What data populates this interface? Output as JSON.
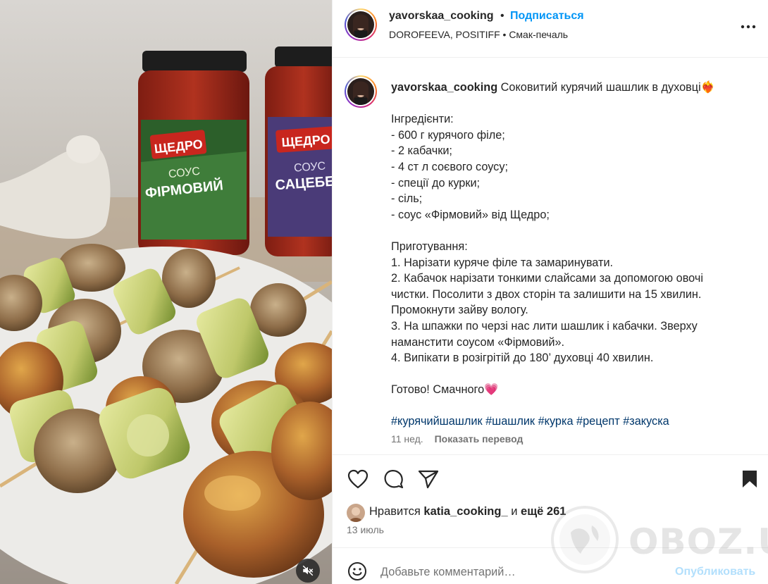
{
  "header": {
    "username": "yavorskaa_cooking",
    "separator": "•",
    "follow_label": "Подписаться",
    "audio": "DOROFEEVA, POSITIFF • Смак-печаль",
    "more_icon": "more-horizontal-icon"
  },
  "media": {
    "jars": [
      {
        "brand": "ЩЕДРО",
        "type": "СОУС",
        "name": "ФІРМОВИЙ",
        "label_color": "#3f7d3a"
      },
      {
        "brand": "ЩЕДРО",
        "type": "СОУС",
        "name": "САЦЕБЕЛ",
        "label_color": "#4a3b78"
      }
    ],
    "mute_icon": "speaker-muted-icon"
  },
  "caption": {
    "username": "yavorskaa_cooking",
    "title": "Соковитий курячий шашлик в духовці",
    "title_emoji": "❤️‍🔥",
    "ingredients_header": "Інгредієнти:",
    "ingredients": [
      "- 600 г курячого філе;",
      "- 2 кабачки;",
      "- 4 ст л соєвого соусу;",
      "- спеції до курки;",
      "- сіль;",
      "- соус «Фірмовий» від Щедро;"
    ],
    "steps_header": "Приготування:",
    "steps_lines": [
      "1. Нарізати куряче філе та замаринувати.",
      "2. Кабачок нарізати тонкими слайсами за допомогою овочі",
      "чистки. Посолити з двох сторін та залишити на 15 хвилин.",
      "Промокнути зайву вологу.",
      "3. На шпажки по черзі нас лити шашлик і кабачки. Зверху",
      "наманстити соусом «Фірмовий».",
      "4. Випікати в розігрітій до 180’ духовці 40 хвилин."
    ],
    "closing": "Готово! Смачного",
    "closing_emoji": "💗",
    "hashtags": [
      "#курячийшашлик",
      "#шашлик",
      "#курка",
      "#рецепт",
      "#закуска"
    ],
    "age": "11 нед.",
    "translate_label": "Показать перевод"
  },
  "actions": {
    "like_icon": "heart-icon",
    "comment_icon": "comment-bubble-icon",
    "share_icon": "paper-plane-icon",
    "save_icon": "bookmark-icon",
    "likes_prefix": "Нравится",
    "likes_user": "katia_cooking_",
    "likes_middle": "и",
    "likes_others": "ещё 261",
    "date": "13 июль"
  },
  "comment": {
    "placeholder": "Добавьте комментарий…",
    "publish_label": "Опубликовать",
    "emoji_icon": "smiley-icon"
  },
  "watermark": {
    "text": "OBOZ.UA"
  },
  "colors": {
    "accent": "#0095f6",
    "accent_disabled": "#b2dffc",
    "hashtag": "#00376b",
    "muted": "#737373"
  }
}
